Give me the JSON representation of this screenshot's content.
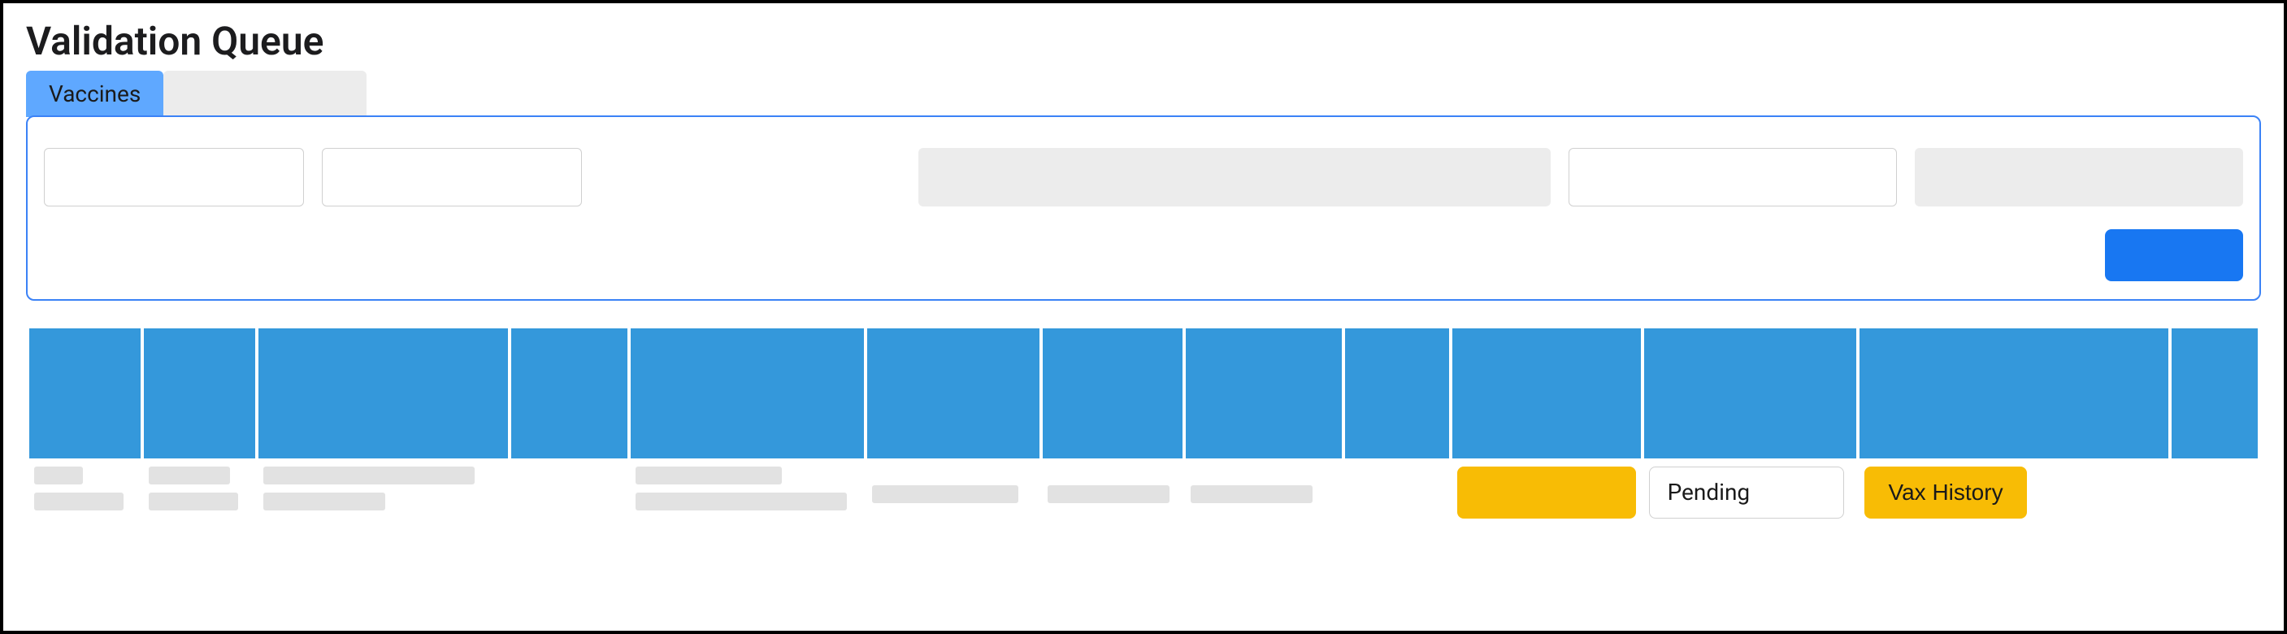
{
  "page": {
    "title": "Validation Queue"
  },
  "tabs": [
    {
      "label": "Vaccines",
      "active": true
    },
    {
      "label": "",
      "active": false
    }
  ],
  "filters": {
    "field1": "",
    "field2": "",
    "field3": "",
    "field4": "",
    "field5": ""
  },
  "actions": {
    "primary_label": ""
  },
  "table": {
    "headers": [
      "",
      "",
      "",
      "",
      "",
      "",
      "",
      "",
      "",
      "",
      "",
      "",
      ""
    ],
    "rows": [
      {
        "status": "Pending",
        "action_primary": "",
        "action_secondary": "Vax History"
      }
    ]
  }
}
